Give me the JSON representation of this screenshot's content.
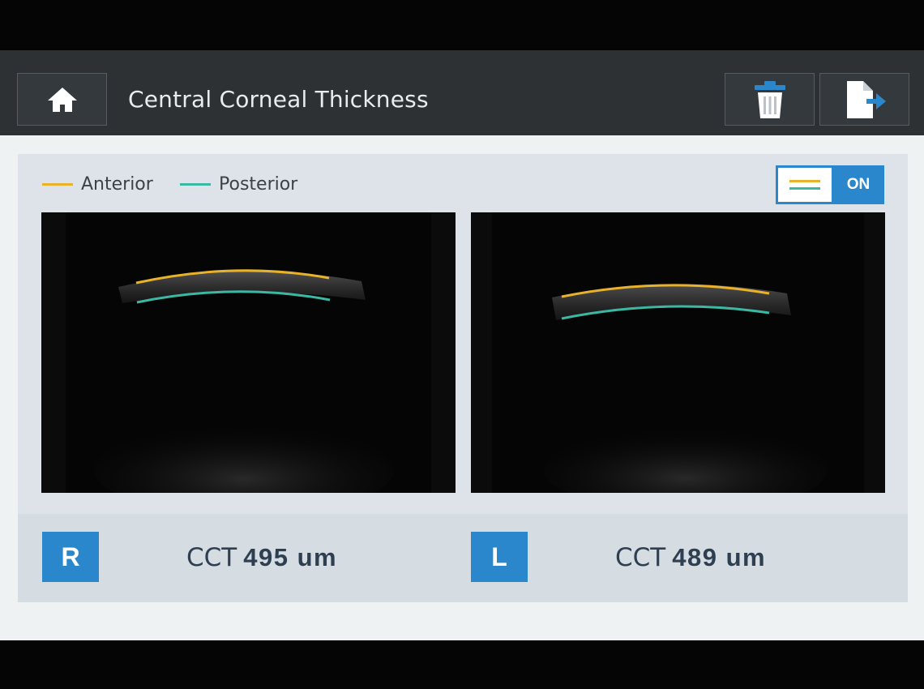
{
  "header": {
    "title": "Central Corneal Thickness",
    "home_icon": "home-icon",
    "trash_icon": "trash-icon",
    "export_icon": "export-icon"
  },
  "legend": {
    "anterior": {
      "label": "Anterior",
      "color": "#e8b22a"
    },
    "posterior": {
      "label": "Posterior",
      "color": "#3bb8a3"
    }
  },
  "toggle": {
    "icon": "lines-icon",
    "state": "ON"
  },
  "eyes": {
    "right": {
      "badge": "R",
      "prefix": "CCT",
      "value": "495 um"
    },
    "left": {
      "badge": "L",
      "prefix": "CCT",
      "value": "489 um"
    }
  },
  "colors": {
    "accent": "#2a87cc",
    "header_bg": "#2d3134"
  }
}
